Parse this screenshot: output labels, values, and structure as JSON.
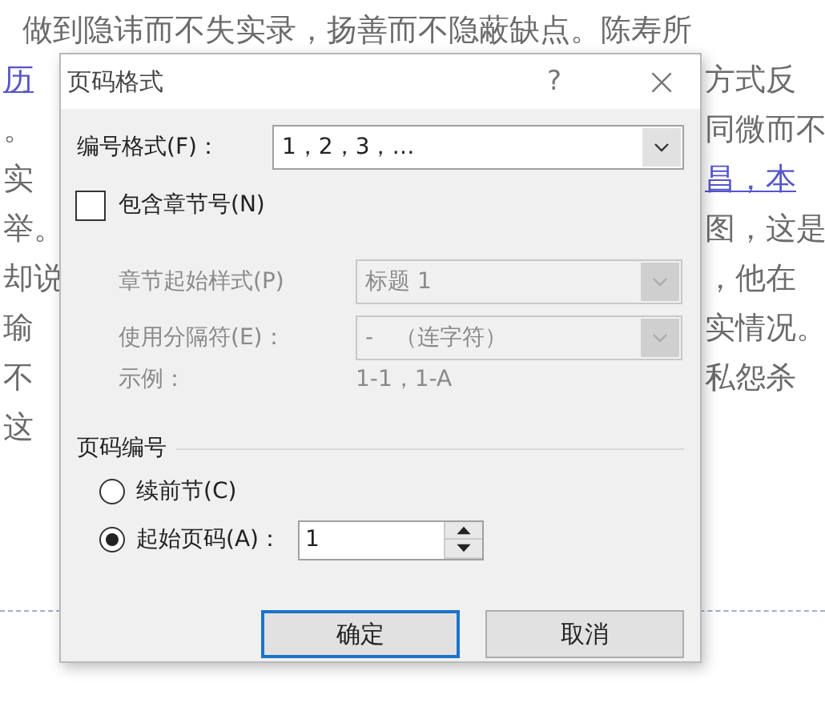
{
  "document": {
    "lines": [
      {
        "kind": "full",
        "text": "做到隐讳而不失实录，扬善而不隐蔽缺点。陈寿所"
      },
      {
        "kind": "split",
        "left": "历",
        "left_link": true,
        "right": "方式反",
        "right_link": false
      },
      {
        "kind": "split",
        "left": "。",
        "left_link": false,
        "right": "同微而不",
        "right_link": false
      },
      {
        "kind": "split",
        "left": "实",
        "left_link": false,
        "right": "昌，本",
        "right_link": true
      },
      {
        "kind": "split",
        "left": "举。",
        "left_link": false,
        "right": "图，这是",
        "right_link": false
      },
      {
        "kind": "split",
        "left": "却说",
        "left_link": false,
        "right": "，他在",
        "right_link": false
      },
      {
        "kind": "split",
        "left": "瑜",
        "left_link": false,
        "right": "实情况。",
        "right_link": false
      },
      {
        "kind": "split",
        "left": "不",
        "left_link": false,
        "right": "私怨杀",
        "right_link": false
      },
      {
        "kind": "split",
        "left": "这",
        "left_link": false
      }
    ]
  },
  "dialog": {
    "title": "页码格式",
    "help": "?",
    "close": "×",
    "number_format": {
      "label": "编号格式(F)：",
      "value": "1，2，3，…"
    },
    "include_chapter": {
      "label": "包含章节号(N)",
      "checked": false
    },
    "chapter_style": {
      "label": "章节起始样式(P)",
      "value": "标题 1",
      "disabled": true
    },
    "separator": {
      "label": "使用分隔符(E)：",
      "value": "-   （连字符）",
      "disabled": true
    },
    "example": {
      "label": "示例：",
      "value": "1-1，1-A",
      "disabled": true
    },
    "numbering": {
      "title": "页码编号",
      "options": [
        {
          "label": "续前节(C)",
          "selected": false
        },
        {
          "label": "起始页码(A)：",
          "selected": true,
          "spin_value": "1"
        }
      ]
    },
    "buttons": [
      {
        "label": "确定",
        "default": true
      },
      {
        "label": "取消",
        "default": false
      }
    ]
  }
}
